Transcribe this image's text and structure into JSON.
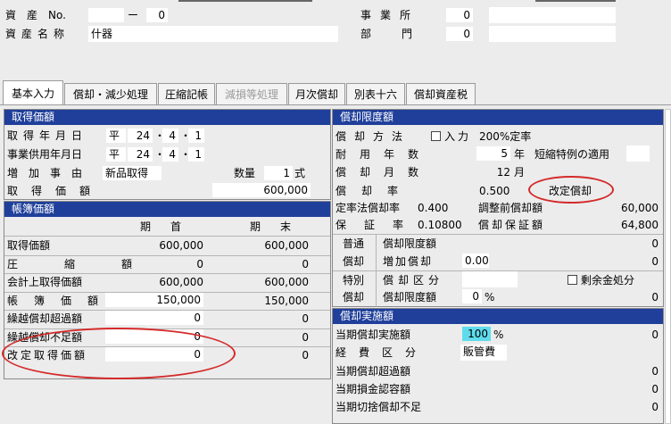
{
  "header": {
    "asset_no_label": "資　産　No.",
    "asset_no_prefix": "",
    "asset_no_dash": "ー",
    "asset_no_value": "0",
    "asset_name_label": "資産名称",
    "asset_name_value": "什器",
    "office_label": "事業所",
    "office_code": "0",
    "office_name": "",
    "dept_label": "部門",
    "dept_code": "0",
    "dept_name": ""
  },
  "tabs": [
    {
      "label": "基本入力",
      "active": true
    },
    {
      "label": "償却・減少処理"
    },
    {
      "label": "圧縮記帳"
    },
    {
      "label": "減損等処理",
      "disabled": true
    },
    {
      "label": "月次償却"
    },
    {
      "label": "別表十六"
    },
    {
      "label": "償却資産税"
    }
  ],
  "acquisition": {
    "title": "取得価額",
    "acq_date_label": "取得年月日",
    "acq_era": "平",
    "acq_year": "24",
    "acq_month": "4",
    "acq_day": "1",
    "use_date_label": "事業供用年月日",
    "use_era": "平",
    "use_year": "24",
    "use_month": "4",
    "use_day": "1",
    "reason_label": "増加事由",
    "reason_value": "新品取得",
    "qty_label": "数量",
    "qty_value": "1",
    "qty_unit": "式",
    "price_label": "取得価額",
    "price_value": "600,000"
  },
  "books": {
    "title": "帳簿価額",
    "col_begin": "期首",
    "col_end": "期末",
    "rows": [
      {
        "label": "取得価額",
        "begin": "600,000",
        "end": "600,000"
      },
      {
        "label": "圧縮額",
        "begin": "0",
        "end": "0"
      },
      {
        "label": "会計上取得価額",
        "begin": "600,000",
        "end": "600,000"
      },
      {
        "label": "帳簿価額",
        "begin": "150,000",
        "end": "150,000"
      },
      {
        "label": "繰越償却超過額",
        "begin": "0",
        "end": "0"
      },
      {
        "label": "繰越償却不足額",
        "begin": "0",
        "end": "0"
      },
      {
        "label": "改定取得価額",
        "begin": "0",
        "end": "0"
      }
    ]
  },
  "limit": {
    "title": "償却限度額",
    "method_label": "償却方法",
    "input_label": "入力",
    "method_value": "200%定率",
    "life_label": "耐用年数",
    "life_value": "5",
    "life_unit": "年",
    "special_label": "短縮特例の適用",
    "special_value": "",
    "months_label": "償却月数",
    "months_value": "12",
    "months_unit": "月",
    "rate_label": "償却率",
    "rate_value": "0.500",
    "revised_label": "改定償却",
    "fixed_rate_label": "定率法償却率",
    "fixed_rate_value": "0.400",
    "pre_adjust_label": "調整前償却額",
    "pre_adjust_value": "60,000",
    "guarantee_rate_label": "保証率",
    "guarantee_rate_value": "0.10800",
    "guarantee_amount_label": "償却保証額",
    "guarantee_amount_value": "64,800",
    "normal_label1": "普通",
    "normal_label2": "償却",
    "normal_limit_label": "償却限度額",
    "normal_limit_value": "0",
    "additional_label": "増加償却",
    "additional_value": "0.00",
    "additional_amount": "0",
    "special_label1": "特別",
    "special_label2": "償却",
    "class_label": "償却区分",
    "class_value": "",
    "surplus_label": "剰余金処分",
    "special_limit_label": "償却限度額",
    "special_limit_pct": "0",
    "pct_sign": "%",
    "special_limit_value": "0"
  },
  "execution": {
    "title": "償却実施額",
    "exec_label": "当期償却実施額",
    "exec_pct": "100",
    "pct_sign": "%",
    "exec_value": "0",
    "expense_label": "経費区分",
    "expense_value": "販管費",
    "excess_label": "当期償却超過額",
    "excess_value": "0",
    "allowed_label": "当期損金認容額",
    "allowed_value": "0",
    "cut_label": "当期切捨償却不足",
    "cut_value": "0"
  }
}
